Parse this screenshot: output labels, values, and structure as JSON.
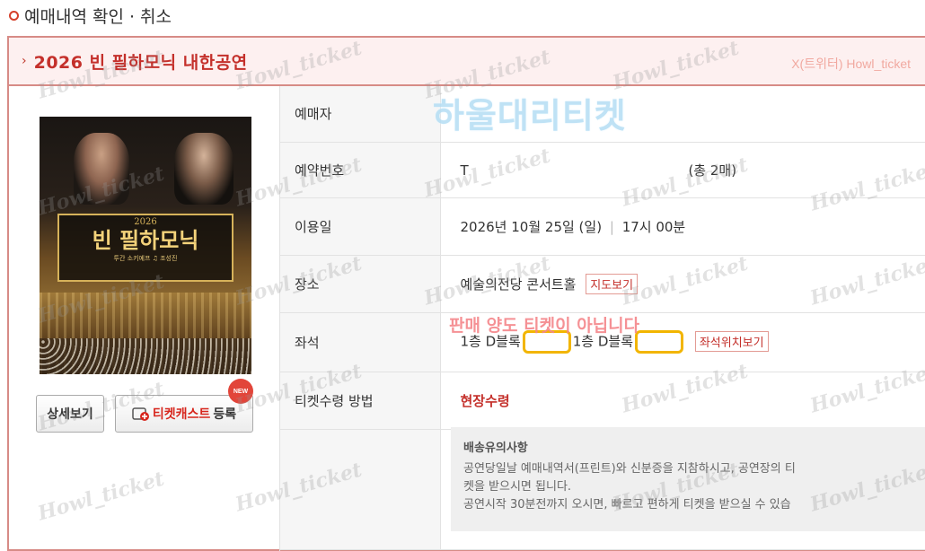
{
  "page": {
    "header": "예매내역 확인 · 취소"
  },
  "section": {
    "title": "2026 빈 필하모닉 내한공연",
    "twitter": "X(트위터) Howl_ticket"
  },
  "poster": {
    "year": "2026",
    "name": "빈 필하모닉",
    "sub": "투간 소키예프 ♫ 조성진"
  },
  "buttons": {
    "detail": "상세보기",
    "ticketcast_prefix": "티켓캐스트",
    "ticketcast_suffix": "등록",
    "new_badge": "NEW"
  },
  "overlay": {
    "brand": "하울대리티켓",
    "notice": "판매 양도 티켓이 아닙니다",
    "watermark": "Howl_ticket"
  },
  "info": {
    "booker_label": "예매자",
    "booker_value": "",
    "reservation_label": "예약번호",
    "reservation_value": "T",
    "reservation_count": "(총 2매)",
    "date_label": "이용일",
    "date_value": "2026년 10월 25일 (일)",
    "time_value": "17시 00분",
    "venue_label": "장소",
    "venue_value": "예술의전당 콘서트홀",
    "venue_map_button": "지도보기",
    "seat_label": "좌석",
    "seat1": "1층 D블록",
    "seat2": "1층 D블록",
    "seat_map_button": "좌석위치보기",
    "pickup_label": "티켓수령 방법",
    "pickup_value": "현장수령"
  },
  "delivery": {
    "title": "배송유의사항",
    "line1": "공연당일날 예매내역서(프린트)와 신분증을 지참하시고, 공연장의 티",
    "line2": "켓을 받으시면 됩니다.",
    "line3": "공연시작 30분전까지 오시면, 빠르고 편하게 티켓을 받으실 수 있습"
  },
  "colors": {
    "accent_red": "#c4302b",
    "seat_highlight": "#f2b500"
  }
}
